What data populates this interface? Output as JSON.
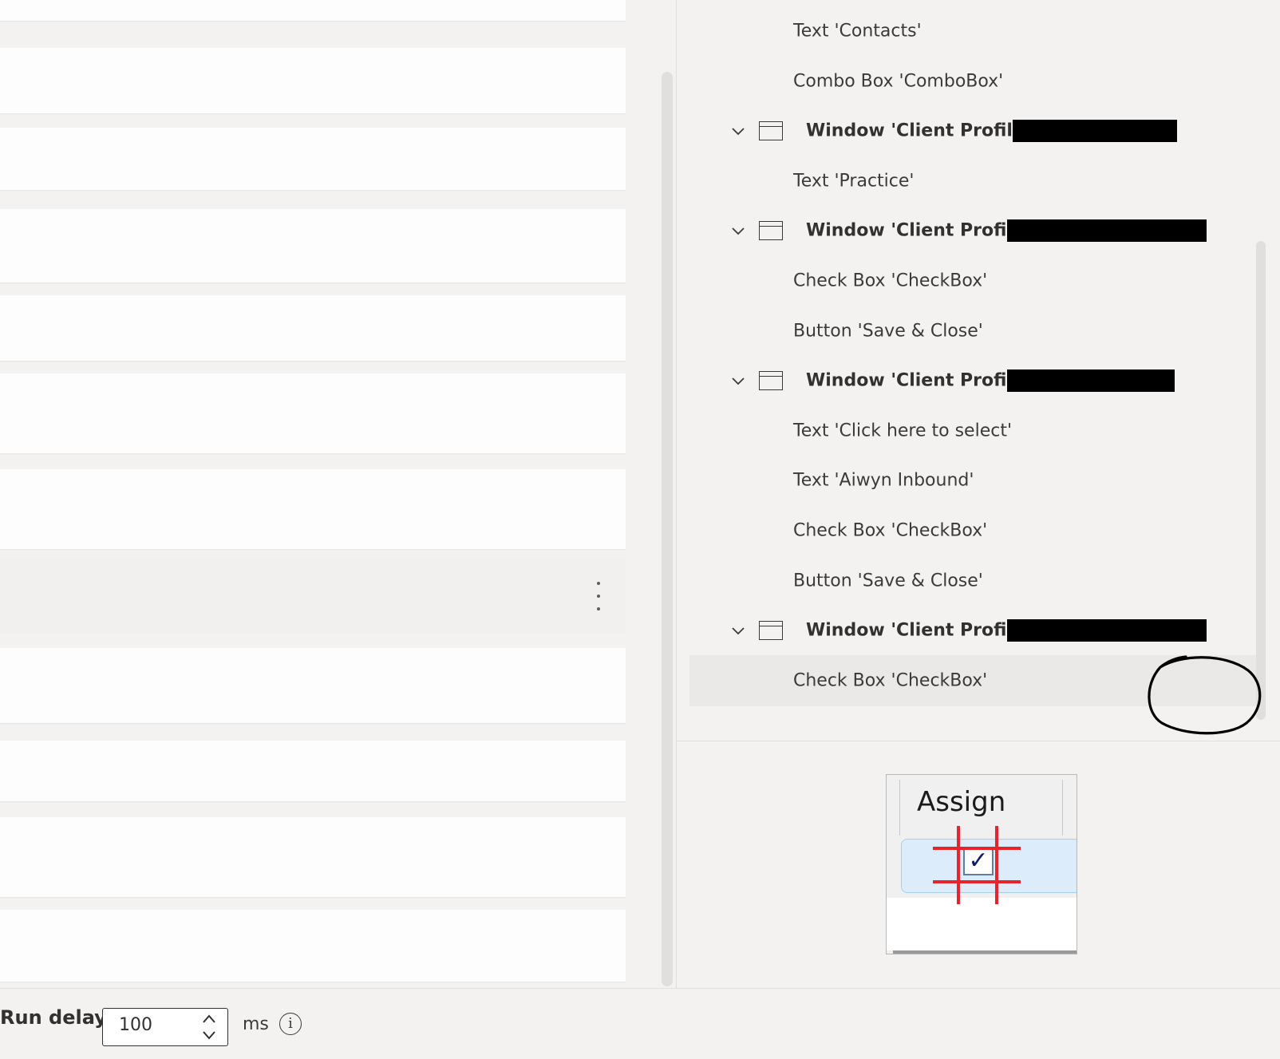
{
  "ui_elements_tree": {
    "items": [
      {
        "label": "Text 'Contacts'",
        "kind": "leaf"
      },
      {
        "label": "Combo Box 'ComboBox'",
        "kind": "leaf"
      },
      {
        "label": "Window 'Client Profile -",
        "kind": "window",
        "redacted": true
      },
      {
        "label": "Text 'Practice'",
        "kind": "leaf"
      },
      {
        "label": "Window 'Client Profile -",
        "kind": "window",
        "redacted": true
      },
      {
        "label": "Check Box 'CheckBox'",
        "kind": "leaf"
      },
      {
        "label": "Button 'Save & Close'",
        "kind": "leaf"
      },
      {
        "label": "Window 'Client Profile -",
        "kind": "window",
        "redacted": true
      },
      {
        "label": "Text 'Click here to select'",
        "kind": "leaf"
      },
      {
        "label": "Text 'Aiwyn Inbound'",
        "kind": "leaf"
      },
      {
        "label": "Check Box 'CheckBox'",
        "kind": "leaf"
      },
      {
        "label": "Button 'Save & Close'",
        "kind": "leaf"
      },
      {
        "label": "Window 'Client Profile -",
        "kind": "window",
        "redacted": true
      },
      {
        "label": "Check Box 'CheckBox'",
        "kind": "leaf",
        "selected": true
      }
    ]
  },
  "preview": {
    "header_text": "Assign",
    "checkbox_glyph": "✓"
  },
  "bottom_bar": {
    "run_delay_label": "Run delay",
    "delay_value": "100",
    "unit": "ms",
    "info_glyph": "i"
  },
  "icons": {
    "window_node": "window-icon",
    "expand": "chevron-down-icon",
    "more": "more-vertical-icon",
    "info": "info-icon",
    "spin_up": "chevron-up-icon",
    "spin_down": "chevron-down-icon"
  },
  "colors": {
    "panel_background": "#f3f2f1",
    "row_background": "#fdfdfd",
    "selected_row": "#ebe9e8",
    "redaction": "#000000",
    "target_marker": "#e8242a"
  }
}
